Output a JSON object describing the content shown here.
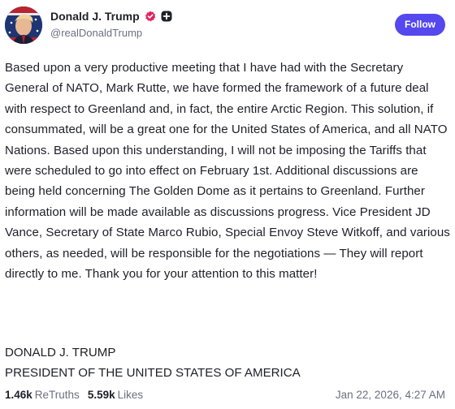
{
  "author": {
    "display_name": "Donald J. Trump",
    "handle": "@realDonaldTrump",
    "avatar_icon": "profile-avatar",
    "verified_icon": "verified-badge-icon",
    "verified_color": "#e0245e",
    "plus_icon": "plus-badge-icon"
  },
  "follow_button": {
    "label": "Follow",
    "color": "#5448ee"
  },
  "post": {
    "body": "Based upon a very productive meeting that I have had with the Secretary General of NATO, Mark Rutte, we have formed the framework of a future deal with respect to Greenland and, in fact, the entire Arctic Region. This solution, if consummated, will be a great one for the United States of America, and all NATO Nations. Based upon this understanding, I will not be imposing the Tariffs that were scheduled to go into effect on February 1st. Additional discussions are being held concerning The Golden Dome as it pertains to Greenland. Further information will be made available as discussions progress. Vice President JD Vance, Secretary of State Marco Rubio, Special Envoy Steve Witkoff, and various others, as needed, will be responsible for the negotiations — They will report directly to me. Thank you for your attention to this matter!",
    "signature_line1": "DONALD J. TRUMP",
    "signature_line2": "PRESIDENT OF THE UNITED STATES OF AMERICA"
  },
  "stats": {
    "retruths_count": "1.46k",
    "retruths_label": "ReTruths",
    "likes_count": "5.59k",
    "likes_label": "Likes"
  },
  "timestamp": "Jan 22, 2026, 4:27 AM"
}
